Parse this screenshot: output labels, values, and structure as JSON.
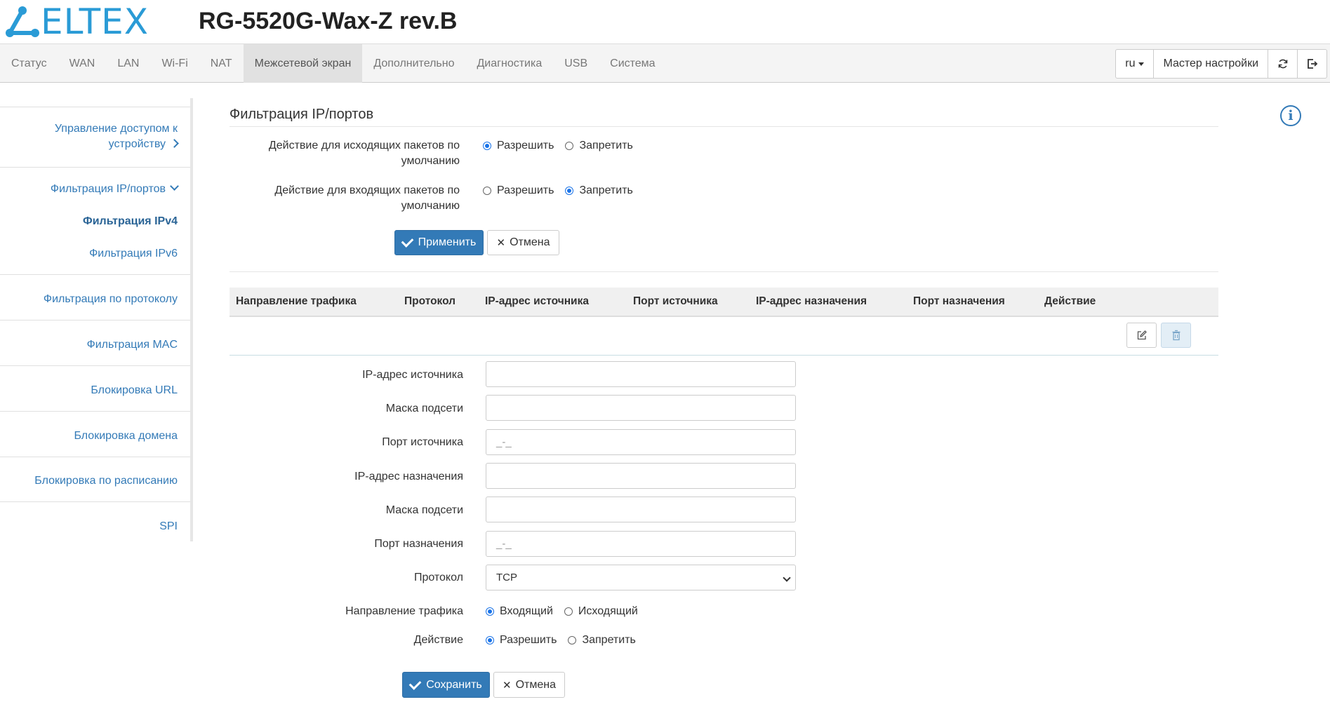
{
  "header": {
    "logo_text": "ELTEX",
    "model": "RG-5520G-Wax-Z rev.B",
    "brand_color": "#2a9bd6"
  },
  "nav": {
    "items": [
      "Статус",
      "WAN",
      "LAN",
      "Wi-Fi",
      "NAT",
      "Межсетевой экран",
      "Дополнительно",
      "Диагностика",
      "USB",
      "Система"
    ],
    "active": "Межсетевой экран",
    "lang": "ru",
    "wizard": "Мастер настройки",
    "refresh_icon": "refresh-icon",
    "logout_icon": "logout-icon"
  },
  "sidebar": {
    "access_control": "Управление доступом к устройству",
    "ip_port_filter": "Фильтрация IP/портов",
    "ipv4": "Фильтрация IPv4",
    "ipv6": "Фильтрация IPv6",
    "protocol_filter": "Фильтрация по протоколу",
    "mac_filter": "Фильтрация MAC",
    "url_block": "Блокировка URL",
    "domain_block": "Блокировка домена",
    "schedule_block": "Блокировка по расписанию",
    "spi": "SPI"
  },
  "main": {
    "title": "Фильтрация IP/портов",
    "outgoing_label": "Действие для исходящих пакетов по умолчанию",
    "incoming_label": "Действие для входящих пакетов по умолчанию",
    "allow": "Разрешить",
    "deny": "Запретить",
    "outgoing_selected": "Разрешить",
    "incoming_selected": "Запретить",
    "apply": "Применить",
    "cancel": "Отмена"
  },
  "table": {
    "columns": [
      "Направление трафика",
      "Протокол",
      "IP-адрес источника",
      "Порт источника",
      "IP-адрес назначения",
      "Порт назначения",
      "Действие"
    ],
    "edit_icon": "edit-icon",
    "delete_icon": "trash-icon"
  },
  "rule_form": {
    "src_ip_label": "IP-адрес источника",
    "src_mask_label": "Маска подсети",
    "src_port_label": "Порт источника",
    "dst_ip_label": "IP-адрес назначения",
    "dst_mask_label": "Маска подсети",
    "dst_port_label": "Порт назначения",
    "protocol_label": "Протокол",
    "direction_label": "Направление трафика",
    "action_label": "Действие",
    "src_ip_value": "",
    "src_mask_value": "",
    "src_port_placeholder": "_-_",
    "dst_ip_value": "",
    "dst_mask_value": "",
    "dst_port_placeholder": "_-_",
    "protocol_value": "TCP",
    "direction_in": "Входящий",
    "direction_out": "Исходящий",
    "direction_selected": "Входящий",
    "action_allow": "Разрешить",
    "action_deny": "Запретить",
    "action_selected": "Разрешить",
    "save": "Сохранить",
    "cancel": "Отмена"
  },
  "colors": {
    "primary": "#337ab7",
    "link": "#337ab7",
    "radio_selected": "#1a73e8"
  }
}
